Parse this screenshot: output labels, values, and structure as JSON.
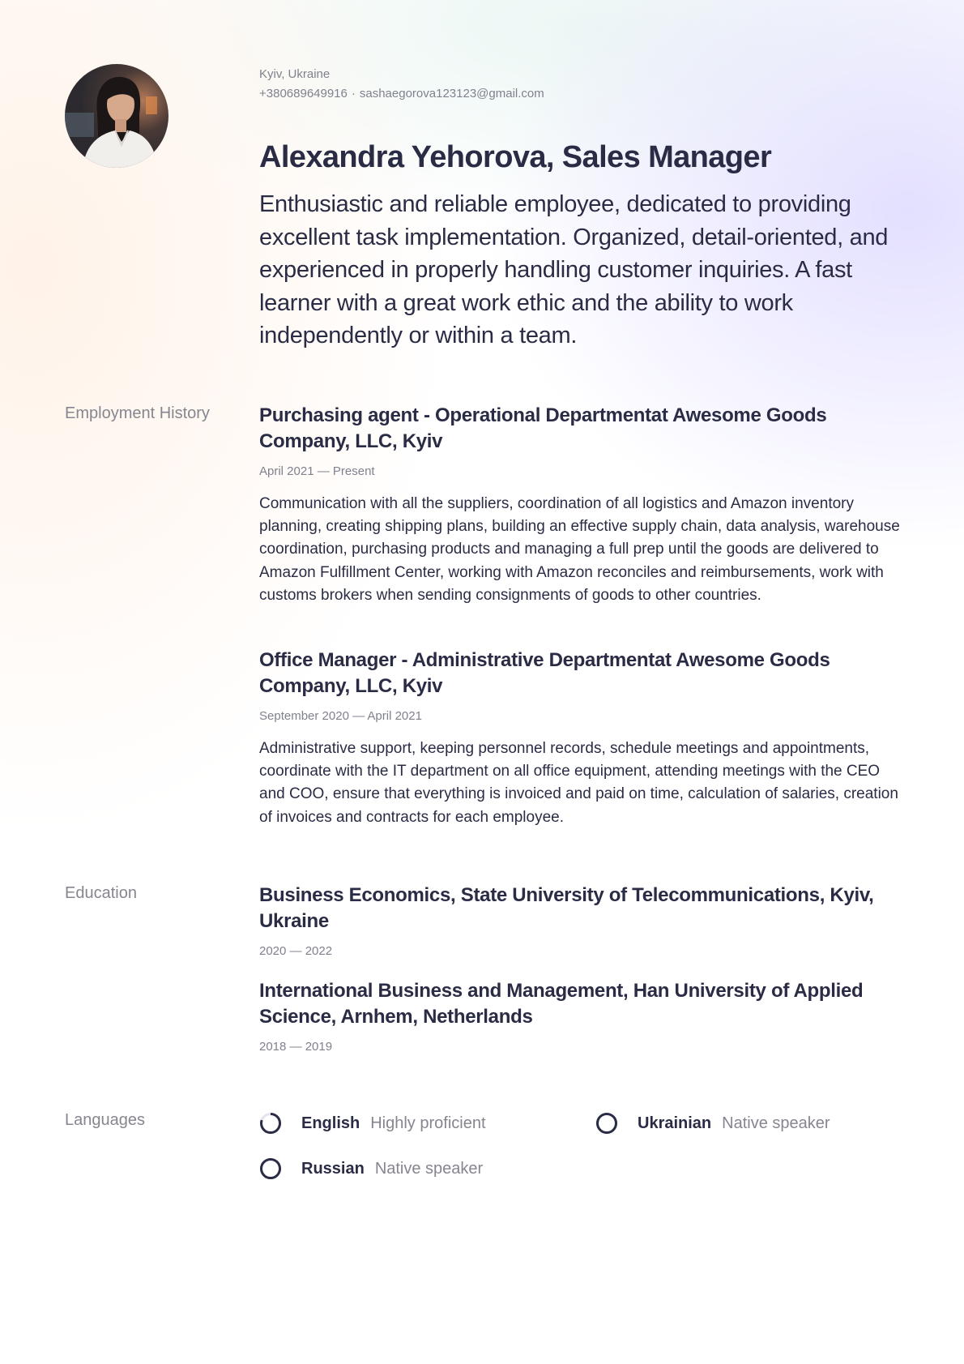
{
  "header": {
    "location": "Kyiv, Ukraine",
    "phone": "+380689649916",
    "separator": "·",
    "email": "sashaegorova123123@gmail.com",
    "name_title": "Alexandra Yehorova, Sales Manager",
    "summary": "Enthusiastic and reliable employee, dedicated to providing excellent task implementation. Organized, detail-oriented, and experienced in properly handling customer inquiries.  A fast learner with a great work ethic and the ability to work independently or within a team."
  },
  "employment": {
    "label": "Employment History",
    "jobs": [
      {
        "title": "Purchasing agent - Operational Departmentat Awesome Goods Company, LLC, Kyiv",
        "dates": "April 2021 — Present",
        "description": "Communication with all the suppliers, coordination of all logistics and Amazon inventory planning, creating shipping plans, building an effective supply chain, data analysis, warehouse coordination, purchasing products and managing a full prep until the goods are delivered to Amazon Fulfillment Center, working with Amazon reconciles and reimbursements, work with customs brokers when sending consignments of goods to other countries."
      },
      {
        "title": "Office Manager - Administrative Departmentat Awesome Goods Company, LLC, Kyiv",
        "dates": "September 2020 — April 2021",
        "description": "Administrative support, keeping personnel records, schedule meetings and appointments, coordinate with the IT department on all office equipment, attending meetings with the CEO and COO, ensure that everything is invoiced and paid on time, calculation of salaries, creation of invoices and contracts for each employee."
      }
    ]
  },
  "education": {
    "label": "Education",
    "items": [
      {
        "title": "Business Economics, State University of Telecommunications, Kyiv, Ukraine",
        "dates": "2020 — 2022"
      },
      {
        "title": "International Business and Management, Han University of Applied Science, Arnhem, Netherlands",
        "dates": "2018 — 2019"
      }
    ]
  },
  "languages": {
    "label": "Languages",
    "items": [
      {
        "name": "English",
        "level": "Highly proficient",
        "proficiency": 0.8
      },
      {
        "name": "Ukrainian",
        "level": "Native speaker",
        "proficiency": 1.0
      },
      {
        "name": "Russian",
        "level": "Native speaker",
        "proficiency": 1.0
      }
    ]
  },
  "colors": {
    "text_primary": "#2a2c45",
    "text_muted": "#80818e",
    "ring_track": "#e3e3ea"
  }
}
